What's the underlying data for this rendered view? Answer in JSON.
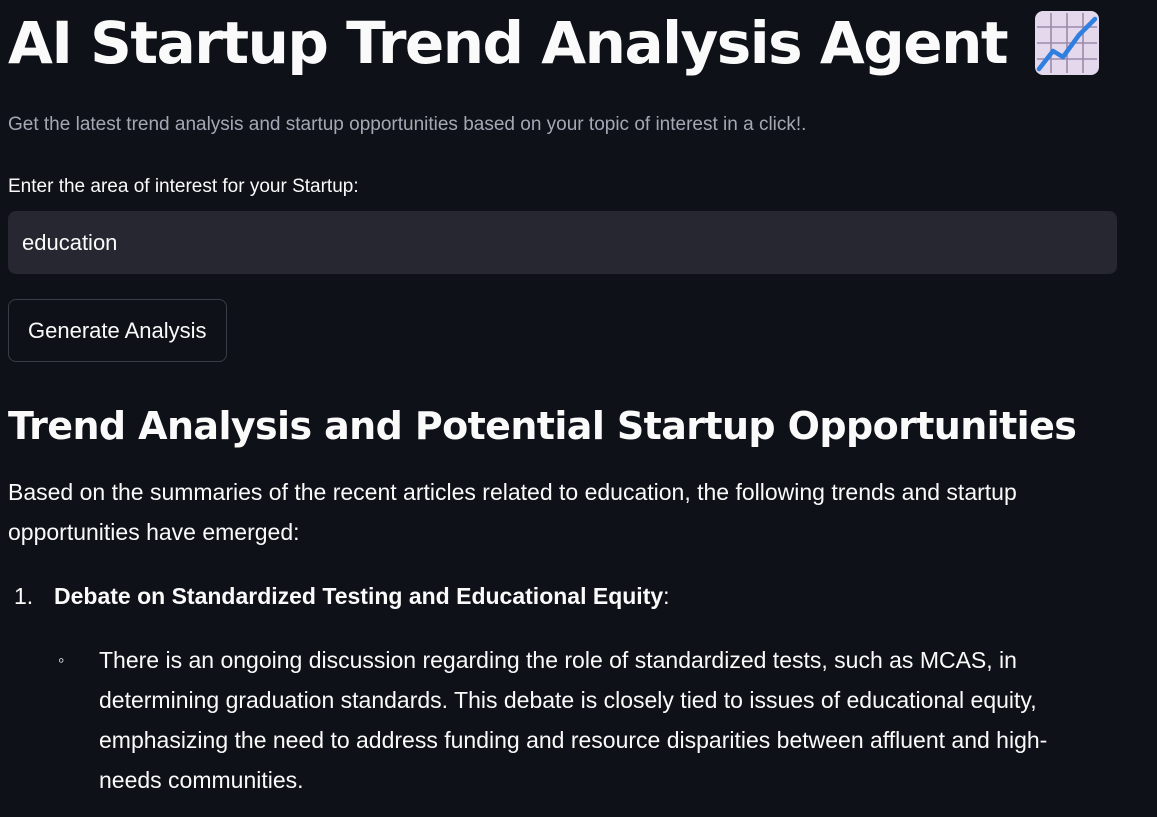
{
  "app": {
    "title": "AI Startup Trend Analysis Agent",
    "title_icon": "chart-increasing-icon",
    "subtitle": "Get the latest trend analysis and startup opportunities based on your topic of interest in a click!."
  },
  "form": {
    "input_label": "Enter the area of interest for your Startup:",
    "input_value": "education",
    "button_label": "Generate Analysis"
  },
  "result": {
    "heading": "Trend Analysis and Potential Startup Opportunities",
    "intro": "Based on the summaries of the recent articles related to education, the following trends and startup opportunities have emerged:",
    "items": [
      {
        "number": "1.",
        "title": "Debate on Standardized Testing and Educational Equity",
        "suffix": ":",
        "bullet": "◦",
        "details": [
          "There is an ongoing discussion regarding the role of standardized tests, such as MCAS, in determining graduation standards. This debate is closely tied to issues of educational equity, emphasizing the need to address funding and resource disparities between affluent and high-needs communities."
        ]
      }
    ]
  },
  "colors": {
    "background": "#0e1117",
    "input_background": "#262730",
    "text": "#fafafa",
    "muted_text": "#a3a8b4",
    "button_border": "#3b3d46"
  }
}
